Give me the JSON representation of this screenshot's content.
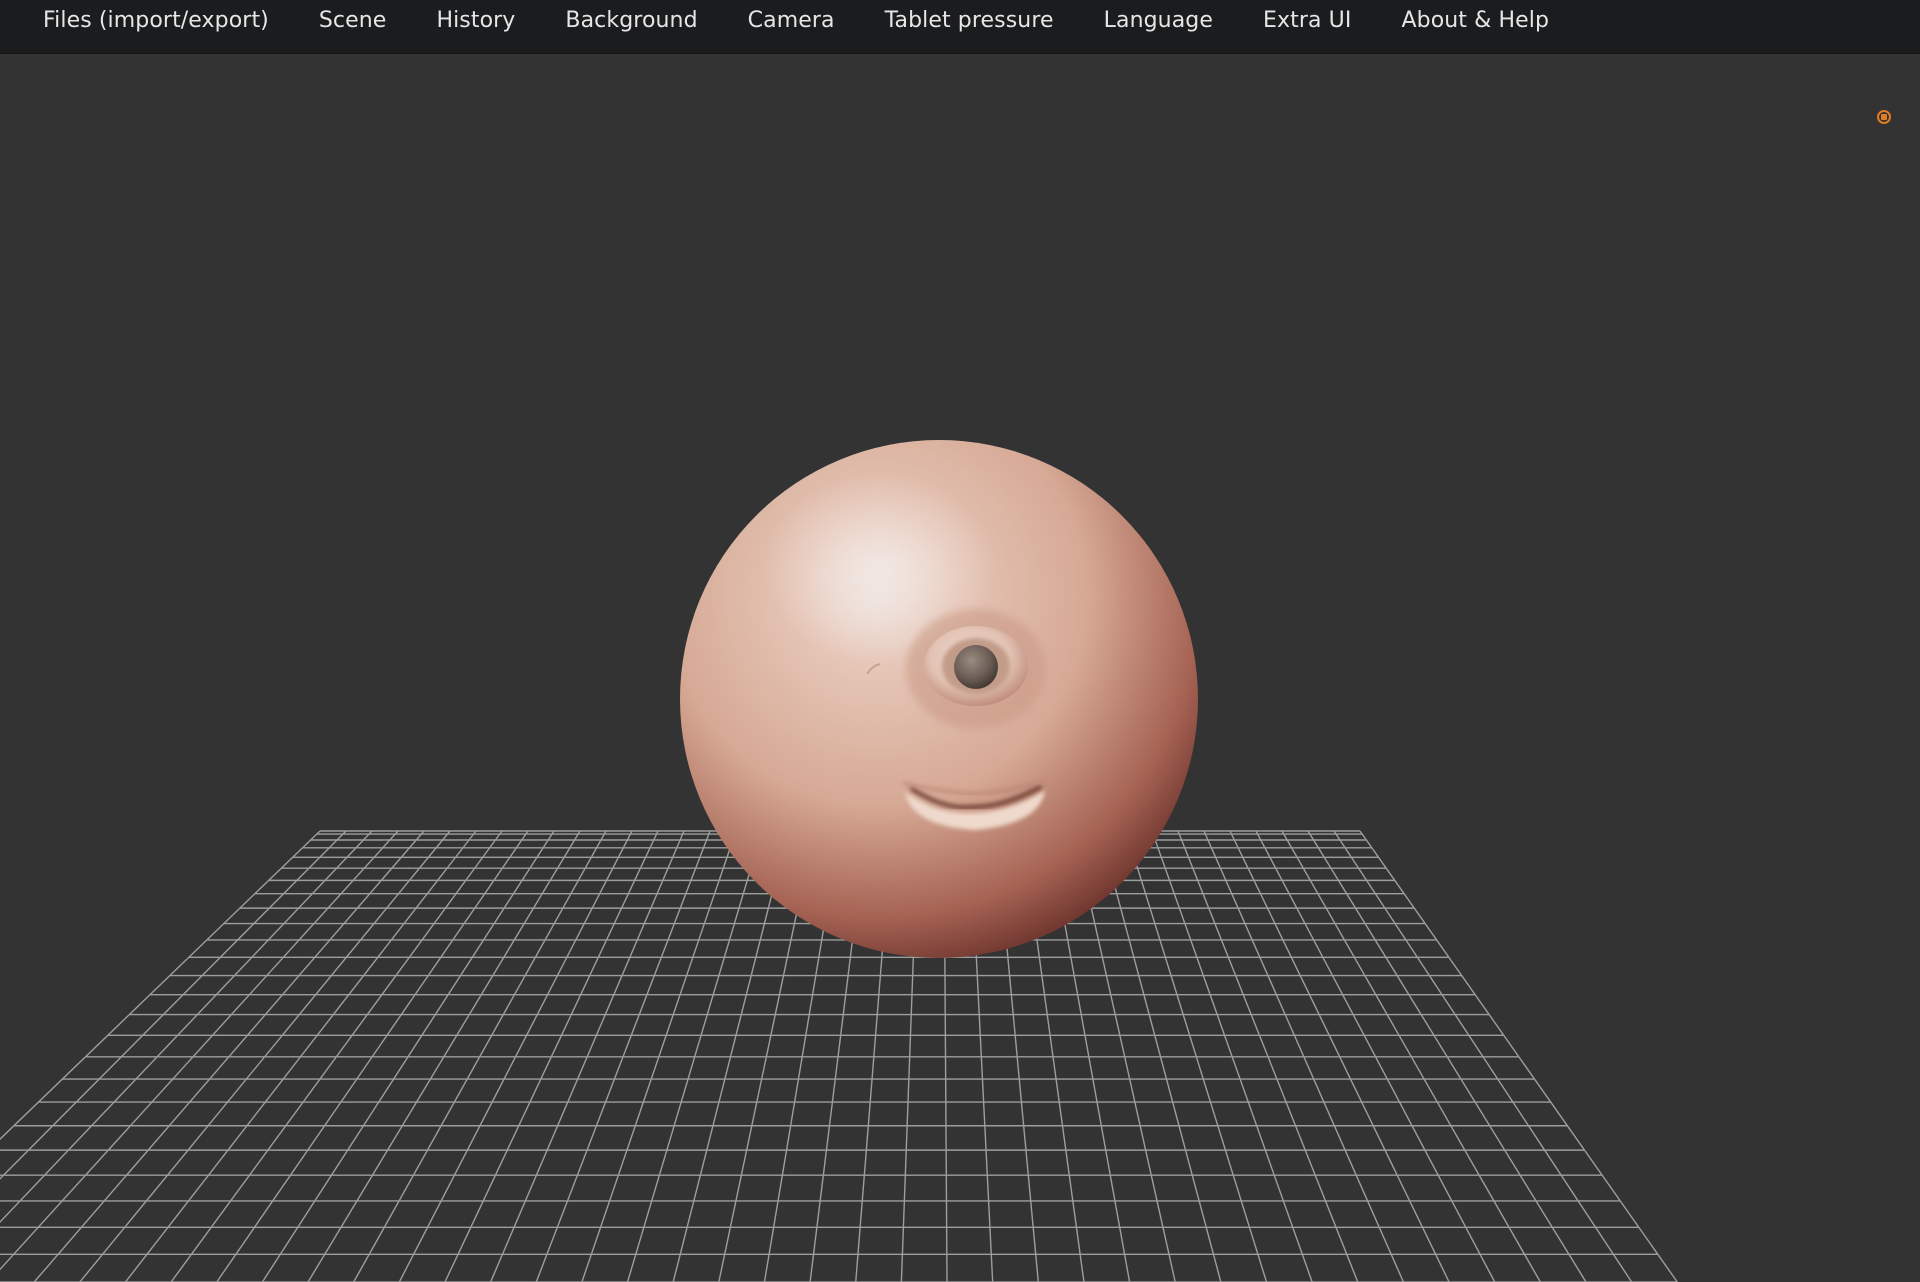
{
  "menu": {
    "items": [
      {
        "label": "Files (import/export)"
      },
      {
        "label": "Scene"
      },
      {
        "label": "History"
      },
      {
        "label": "Background"
      },
      {
        "label": "Camera"
      },
      {
        "label": "Tablet pressure"
      },
      {
        "label": "Language"
      },
      {
        "label": "Extra UI"
      },
      {
        "label": "About & Help"
      }
    ]
  },
  "viewport": {
    "background_color": "#333333",
    "grid_color": "#9a9a9a",
    "mesh": {
      "description_icon": "sculpt-mesh-head",
      "skin_color": "#e8c0ad",
      "shadow_color": "#6e2f27"
    }
  },
  "status": {
    "indicator_icon": "record-indicator-icon",
    "indicator_color": "#e07d24"
  }
}
